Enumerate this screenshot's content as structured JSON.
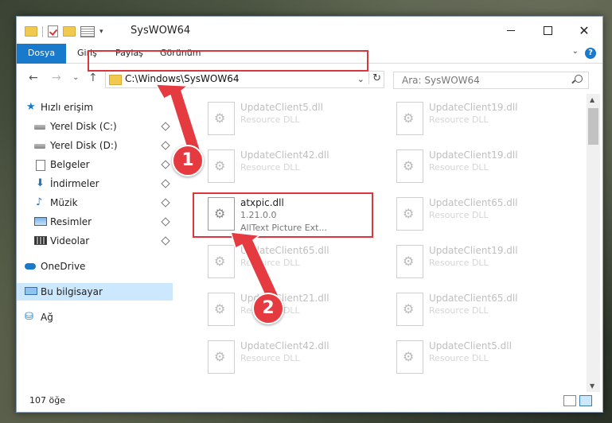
{
  "window": {
    "title": "SysWOW64",
    "ribbon_tabs": [
      "Dosya",
      "Giriş",
      "Paylaş",
      "Görünüm"
    ],
    "help_label": "?"
  },
  "nav": {
    "address": "C:\\Windows\\SysWOW64",
    "search_placeholder": "Ara: SysWOW64"
  },
  "sidebar": {
    "items": [
      {
        "label": "Hızlı erişim",
        "icon": "star-icon"
      },
      {
        "label": "Yerel Disk (C:)",
        "icon": "disk-icon"
      },
      {
        "label": "Yerel Disk (D:)",
        "icon": "disk-icon"
      },
      {
        "label": "Belgeler",
        "icon": "document-icon"
      },
      {
        "label": "İndirmeler",
        "icon": "download-icon"
      },
      {
        "label": "Müzik",
        "icon": "music-icon"
      },
      {
        "label": "Resimler",
        "icon": "pictures-icon"
      },
      {
        "label": "Videolar",
        "icon": "video-icon"
      },
      {
        "label": "OneDrive",
        "icon": "cloud-icon"
      },
      {
        "label": "Bu bilgisayar",
        "icon": "computer-icon"
      },
      {
        "label": "Ağ",
        "icon": "network-icon"
      }
    ]
  },
  "files": [
    {
      "name": "UpdateClient5.dll",
      "desc": "Resource DLL"
    },
    {
      "name": "UpdateClient19.dll",
      "desc": "Resource DLL"
    },
    {
      "name": "UpdateClient42.dll",
      "desc": "Resource DLL"
    },
    {
      "name": "UpdateClient19.dll",
      "desc": "Resource DLL"
    },
    {
      "name": "UpdateClient65.dll",
      "desc": "Resource DLL"
    },
    {
      "name": "UpdateClient65.dll",
      "desc": "Resource DLL"
    },
    {
      "name": "UpdateClient19.dll",
      "desc": "Resource DLL"
    },
    {
      "name": "UpdateClient21.dll",
      "desc": "Resource DLL"
    },
    {
      "name": "UpdateClient65.dll",
      "desc": "Resource DLL"
    },
    {
      "name": "UpdateClient42.dll",
      "desc": "Resource DLL"
    },
    {
      "name": "UpdateClient5.dll",
      "desc": "Resource DLL"
    }
  ],
  "focused_file": {
    "name": "atxpic.dll",
    "version": "1.21.0.0",
    "desc": "AllText Picture Ext..."
  },
  "status": {
    "count": "107 öğe"
  },
  "annotations": {
    "step1": "1",
    "step2": "2",
    "color": "#e53a3f"
  },
  "colors": {
    "accent": "#1979ca",
    "highlight_border": "#d9363e",
    "selected_bg": "#cce8ff"
  }
}
